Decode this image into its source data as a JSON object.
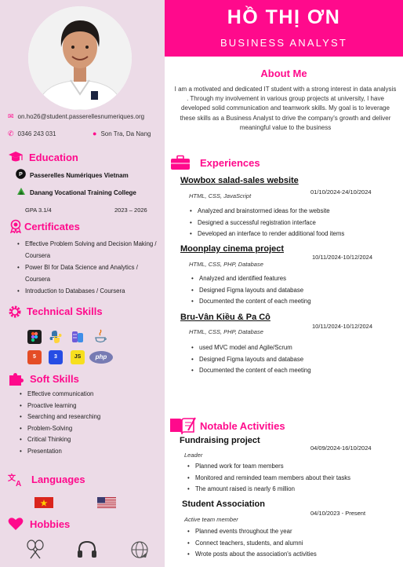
{
  "header": {
    "name": "HỒ THỊ ƠN",
    "role": "BUSINESS ANALYST"
  },
  "contact": {
    "email": "on.ho26@student.passerellesnumeriques.org",
    "phone": "0346 243 031",
    "location": "Son Tra, Da Nang"
  },
  "education": {
    "title": "Education",
    "school1": "Passerelles Numériques Vietnam",
    "school2": "Danang Vocational Training College",
    "gpa": "GPA 3.1/4",
    "years": "2023 – 2026"
  },
  "certificates": {
    "title": "Certificates",
    "items": [
      "Effective Problem Solving and Decision Making / Coursera",
      "Power BI for Data Science and Analytics / Coursera",
      "Introduction to Databases / Coursera"
    ]
  },
  "technical_skills": {
    "title": "Technical Skills",
    "icons": [
      "figma-icon",
      "python-icon",
      "database-icon",
      "java-icon",
      "html5-icon",
      "css3-icon",
      "javascript-icon",
      "php-icon"
    ],
    "php_label": "php"
  },
  "soft_skills": {
    "title": "Soft Skills",
    "items": [
      "Effective communication",
      "Proactive learning",
      "Searching and researching",
      "Problem-Solving",
      "Critical Thinking",
      "Presentation"
    ]
  },
  "languages": {
    "title": "Languages",
    "flags": [
      "vietnam-flag",
      "usa-flag"
    ]
  },
  "hobbies": {
    "title": "Hobbies",
    "icons": [
      "badminton-icon",
      "headphones-icon",
      "globe-travel-icon"
    ]
  },
  "about": {
    "title": "About Me",
    "text": "I am a motivated and dedicated IT student with a strong interest in data analysis . Through my involvement in various group projects at university, I have developed solid communication and teamwork skills. My goal is to leverage these skills as a Business Analyst to drive the company's growth and deliver meaningful value to the business"
  },
  "experiences": {
    "title": "Experiences",
    "jobs": [
      {
        "title": "Wowbox salad-sales website",
        "tech": "HTML, CSS, JavaScript",
        "date": "01/10/2024-24/10/2024",
        "items": [
          "Analyzed and brainstormed ideas for the website",
          "Designed a successful registration interface",
          "Developed an interface to render additional food items"
        ]
      },
      {
        "title": "Moonplay cinema project",
        "tech": "HTML, CSS, PHP, Database",
        "date": "10/11/2024-10/12/2024",
        "items": [
          "Analyzed and identified features",
          "Designed Figma layouts and database",
          "Documented the content of each meeting"
        ]
      },
      {
        "title": "Bru-Vân Kiều & Pa Cô",
        "tech": "HTML, CSS, PHP, Database",
        "date": "10/11/2024-10/12/2024",
        "items": [
          "used MVC model and Agile/Scrum",
          "Designed Figma layouts and database",
          "Documented the content of each meeting"
        ]
      }
    ]
  },
  "activities": {
    "title": "Notable Activities",
    "items": [
      {
        "title": "Fundraising project",
        "role": "Leader",
        "date": "04/09/2024-16/10/2024",
        "items": [
          "Planned work for team members",
          "Monitored and reminded team members about their tasks",
          "The amount raised is nearly 6 million"
        ]
      },
      {
        "title": "Student Association",
        "role": "Active team member",
        "date": "04/10/2023 - Present",
        "items": [
          "Planned events throughout the year",
          "Connect teachers, students, and alumni",
          "Wrote posts about the association's activities"
        ]
      }
    ]
  },
  "colors": {
    "accent": "#ff0a8c",
    "sidebar": "#ecdbe7"
  }
}
